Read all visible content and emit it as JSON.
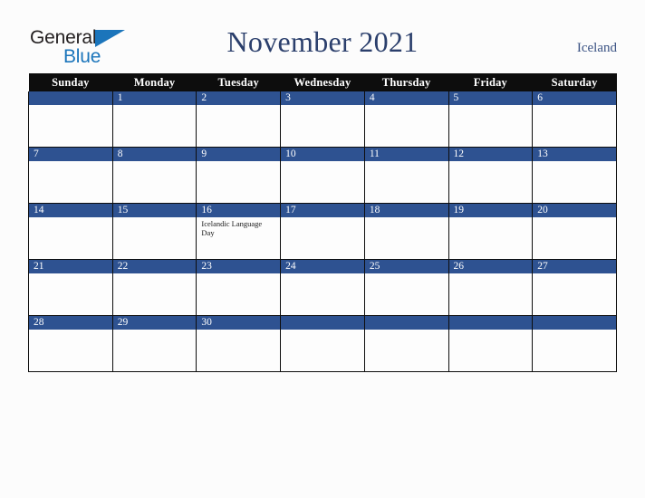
{
  "brand": {
    "name_part1": "General",
    "name_part2": "Blue",
    "triangle_icon": "triangle-icon",
    "colors": {
      "dark": "#231f20",
      "blue": "#1b75bb"
    }
  },
  "header": {
    "title": "November 2021",
    "country": "Iceland",
    "title_color": "#2b3f6c",
    "country_color": "#3a5283"
  },
  "calendar": {
    "month": "November",
    "year": "2021",
    "header_bg": "#0d0d0d",
    "daybar_bg": "#2e5291",
    "weekday_headers": [
      "Sunday",
      "Monday",
      "Tuesday",
      "Wednesday",
      "Thursday",
      "Friday",
      "Saturday"
    ],
    "weeks": [
      [
        {
          "day": "",
          "event": ""
        },
        {
          "day": "1",
          "event": ""
        },
        {
          "day": "2",
          "event": ""
        },
        {
          "day": "3",
          "event": ""
        },
        {
          "day": "4",
          "event": ""
        },
        {
          "day": "5",
          "event": ""
        },
        {
          "day": "6",
          "event": ""
        }
      ],
      [
        {
          "day": "7",
          "event": ""
        },
        {
          "day": "8",
          "event": ""
        },
        {
          "day": "9",
          "event": ""
        },
        {
          "day": "10",
          "event": ""
        },
        {
          "day": "11",
          "event": ""
        },
        {
          "day": "12",
          "event": ""
        },
        {
          "day": "13",
          "event": ""
        }
      ],
      [
        {
          "day": "14",
          "event": ""
        },
        {
          "day": "15",
          "event": ""
        },
        {
          "day": "16",
          "event": "Icelandic Language Day"
        },
        {
          "day": "17",
          "event": ""
        },
        {
          "day": "18",
          "event": ""
        },
        {
          "day": "19",
          "event": ""
        },
        {
          "day": "20",
          "event": ""
        }
      ],
      [
        {
          "day": "21",
          "event": ""
        },
        {
          "day": "22",
          "event": ""
        },
        {
          "day": "23",
          "event": ""
        },
        {
          "day": "24",
          "event": ""
        },
        {
          "day": "25",
          "event": ""
        },
        {
          "day": "26",
          "event": ""
        },
        {
          "day": "27",
          "event": ""
        }
      ],
      [
        {
          "day": "28",
          "event": ""
        },
        {
          "day": "29",
          "event": ""
        },
        {
          "day": "30",
          "event": ""
        },
        {
          "day": "",
          "event": ""
        },
        {
          "day": "",
          "event": ""
        },
        {
          "day": "",
          "event": ""
        },
        {
          "day": "",
          "event": ""
        }
      ]
    ]
  }
}
